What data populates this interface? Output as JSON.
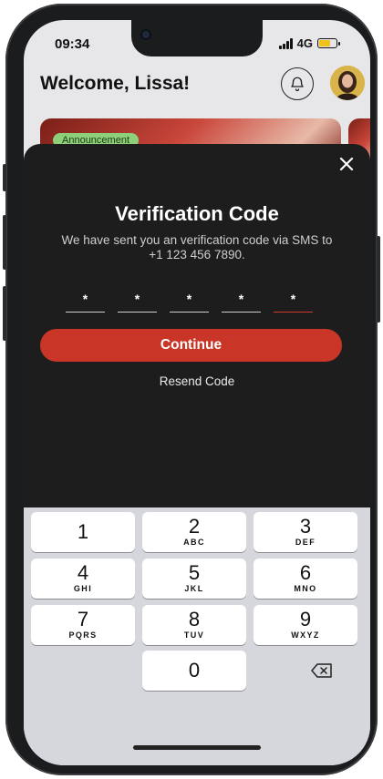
{
  "status": {
    "time": "09:34",
    "network": "4G"
  },
  "header": {
    "welcome_text": "Welcome, Lissa!"
  },
  "banner": {
    "badge": "Announcement"
  },
  "verification": {
    "title": "Verification Code",
    "subtitle": "We have sent you an verification code via SMS to +1 123 456 7890.",
    "digits": [
      "*",
      "*",
      "*",
      "*",
      "*"
    ],
    "continue_label": "Continue",
    "resend_label": "Resend Code"
  },
  "keypad": {
    "keys": [
      {
        "num": "1",
        "letters": ""
      },
      {
        "num": "2",
        "letters": "ABC"
      },
      {
        "num": "3",
        "letters": "DEF"
      },
      {
        "num": "4",
        "letters": "GHI"
      },
      {
        "num": "5",
        "letters": "JKL"
      },
      {
        "num": "6",
        "letters": "MNO"
      },
      {
        "num": "7",
        "letters": "PQRS"
      },
      {
        "num": "8",
        "letters": "TUV"
      },
      {
        "num": "9",
        "letters": "WXYZ"
      },
      {
        "num": "0",
        "letters": ""
      }
    ]
  },
  "icons": {
    "bell": "bell-icon",
    "close": "close-icon",
    "backspace": "backspace-icon",
    "signal": "signal-icon",
    "battery": "battery-icon"
  },
  "colors": {
    "accent": "#c93526",
    "sheet_background": "#1d1d1d",
    "badge": "#8ed07a"
  }
}
